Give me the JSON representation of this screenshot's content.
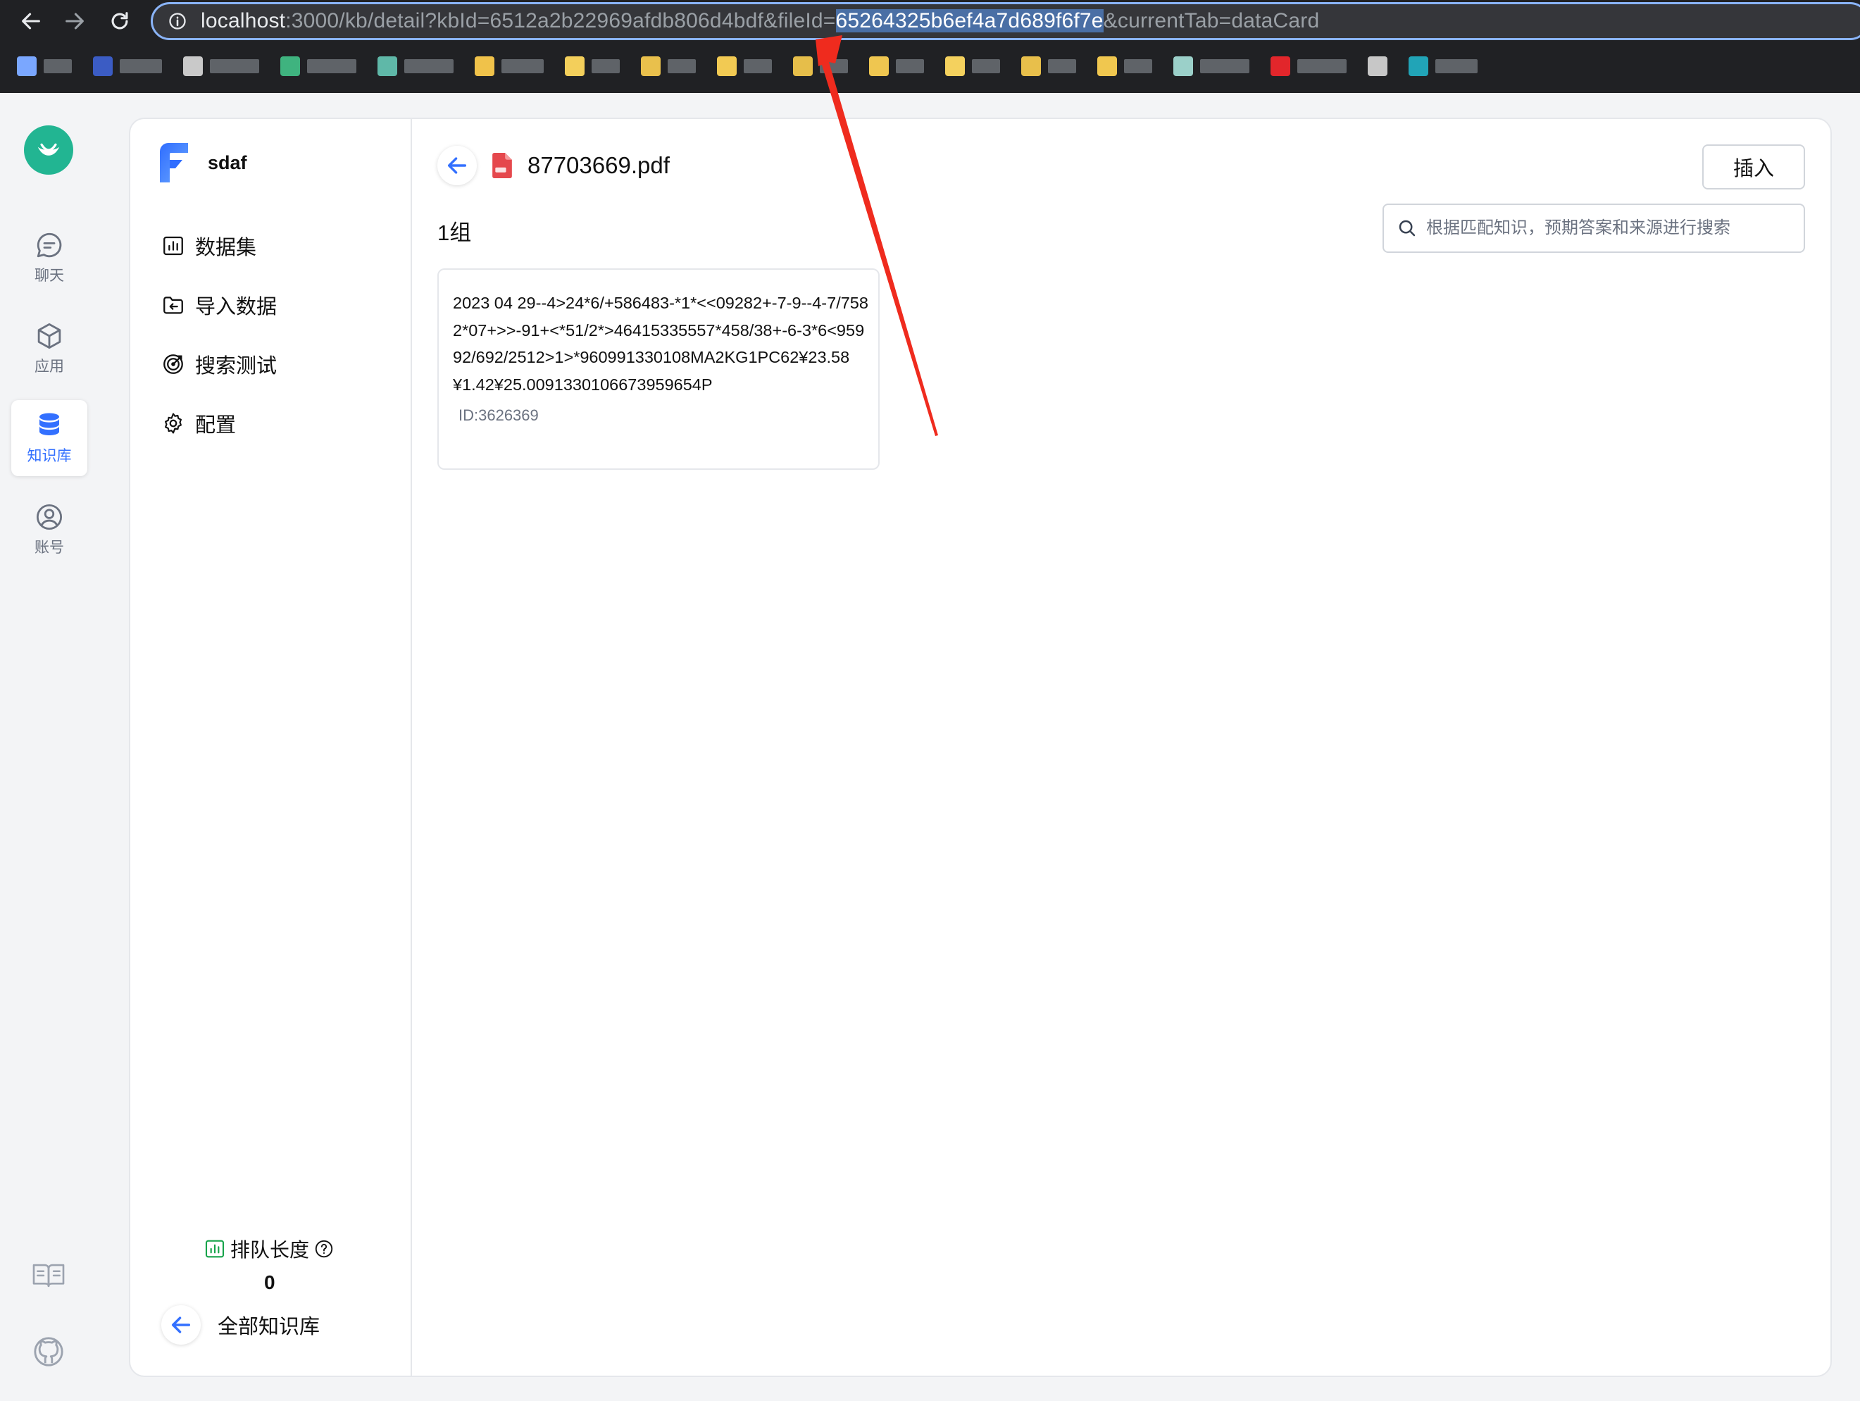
{
  "browser": {
    "url_host": "localhost",
    "url_before_selection": ":3000/kb/detail?kbId=6512a2b22969afdb806d4bdf&fileId=",
    "url_selected": "65264325b6ef4a7d689f6f7e",
    "url_after_selection": "&currentTab=dataCard",
    "bookmark_count": 18
  },
  "rail": {
    "items": [
      {
        "label": "聊天",
        "icon": "chat-icon"
      },
      {
        "label": "应用",
        "icon": "cube-icon"
      },
      {
        "label": "知识库",
        "icon": "database-icon",
        "active": true
      },
      {
        "label": "账号",
        "icon": "user-icon"
      }
    ],
    "bottom_icons": [
      "book-icon",
      "github-icon"
    ]
  },
  "kb": {
    "name": "sdaf",
    "menu": [
      {
        "label": "数据集",
        "icon": "dataset-icon"
      },
      {
        "label": "导入数据",
        "icon": "folder-import-icon"
      },
      {
        "label": "搜索测试",
        "icon": "target-icon"
      },
      {
        "label": "配置",
        "icon": "gear-icon"
      }
    ],
    "queue_label": "排队长度",
    "queue_value": "0",
    "back_label": "全部知识库"
  },
  "main": {
    "file_name": "87703669.pdf",
    "group_title": "1组",
    "insert_label": "插入",
    "search_placeholder": "根据匹配知识，预期答案和来源进行搜索",
    "card": {
      "text": "2023 04 29--4>24*6/+586483-*1*<<09282+-7-9--4-7/7582*07+>>-91+<*51/2*>46415335557*458/38+-6-3*6<95992/692/2512>1>*960991330108MA2KG1PC62¥23.58 ¥1.42¥25.0091330106673959654P",
      "id": "ID:3626369"
    }
  },
  "colors": {
    "accent": "#3370ff",
    "brand_green": "#22b592",
    "annotation_red": "#ef2b1e",
    "pdf_red": "#e5484d"
  }
}
